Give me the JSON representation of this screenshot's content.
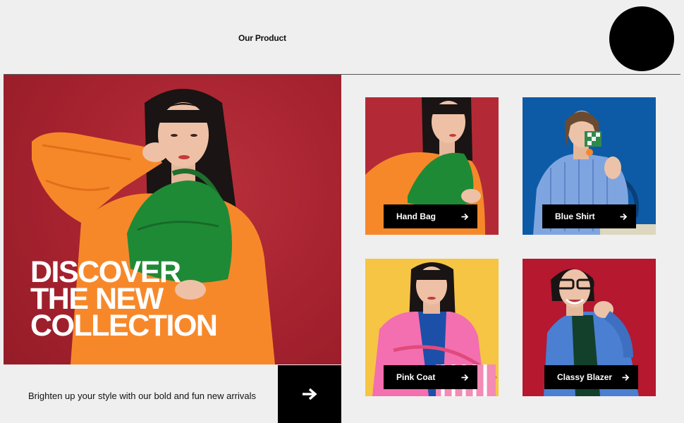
{
  "header": {
    "title": "Our Product"
  },
  "hero": {
    "headline": [
      "DISCOVER",
      "THE NEW",
      "COLLECTION"
    ],
    "tagline": "Brighten up your style with our bold and fun new arrivals",
    "cta_icon": "arrow-right-icon"
  },
  "products": [
    {
      "label": "Hand Bag",
      "bg": "#b32a36",
      "icon": "arrow-right-icon"
    },
    {
      "label": "Blue Shirt",
      "bg": "#0d5ba6",
      "icon": "arrow-right-icon"
    },
    {
      "label": "Pink Coat",
      "bg": "#f6c544",
      "icon": "arrow-right-icon"
    },
    {
      "label": "Classy Blazer",
      "bg": "#b5182f",
      "icon": "arrow-right-icon"
    }
  ],
  "colors": {
    "background": "#efefef",
    "hero_bg": "#a6222f",
    "accent": "#000000",
    "text_on_dark": "#ffffff"
  }
}
